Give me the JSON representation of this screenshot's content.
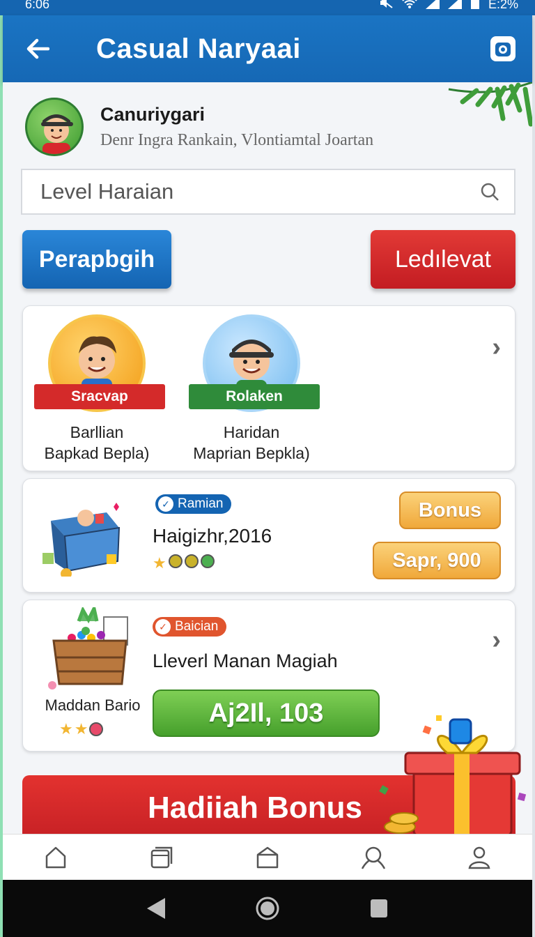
{
  "status_bar": {
    "time": "6:06",
    "battery": "E:2%"
  },
  "app_bar": {
    "title": "Casual Naryaai"
  },
  "profile": {
    "name": "Canuriygari",
    "subtitle": "Denr Ingra Rankain, Vlontiamtal Joartan"
  },
  "search": {
    "placeholder": "Level Haraian"
  },
  "buttons": {
    "primary": "Perapbgih",
    "secondary": "Ledılevat"
  },
  "players": [
    {
      "ribbon": "Sracvap",
      "name_line1": "Barllian",
      "name_line2": "Bapkad Bepla)",
      "ribbon_color": "#d42a2a",
      "medal_color": "#f4a21b"
    },
    {
      "ribbon": "Rolaken",
      "name_line1": "Haridan",
      "name_line2": "Maprian Bepkla)",
      "ribbon_color": "#2f8b3a",
      "medal_color": "#64b5f0"
    }
  ],
  "reward_card": {
    "chip": "Ramian",
    "chip_color": "#1464b2",
    "title": "Haigizhr,2016",
    "bonus_label": "Bonus",
    "amount_label": "Sapr, 900"
  },
  "level_card": {
    "chip": "Baician",
    "chip_color": "#e0552e",
    "title": "Lleverl Manan Magiah",
    "chest_label": "Maddan Bario",
    "action_label": "Aj2Il, 103"
  },
  "banner": {
    "label": "Hadiiah Bonus"
  },
  "bottom_nav": [
    "home-icon",
    "cards-icon",
    "store-icon",
    "search-icon",
    "profile-icon"
  ],
  "colors": {
    "primary_blue": "#1668b5",
    "accent_red": "#c31c22",
    "gold": "#f0a83a",
    "green": "#46a02c"
  }
}
